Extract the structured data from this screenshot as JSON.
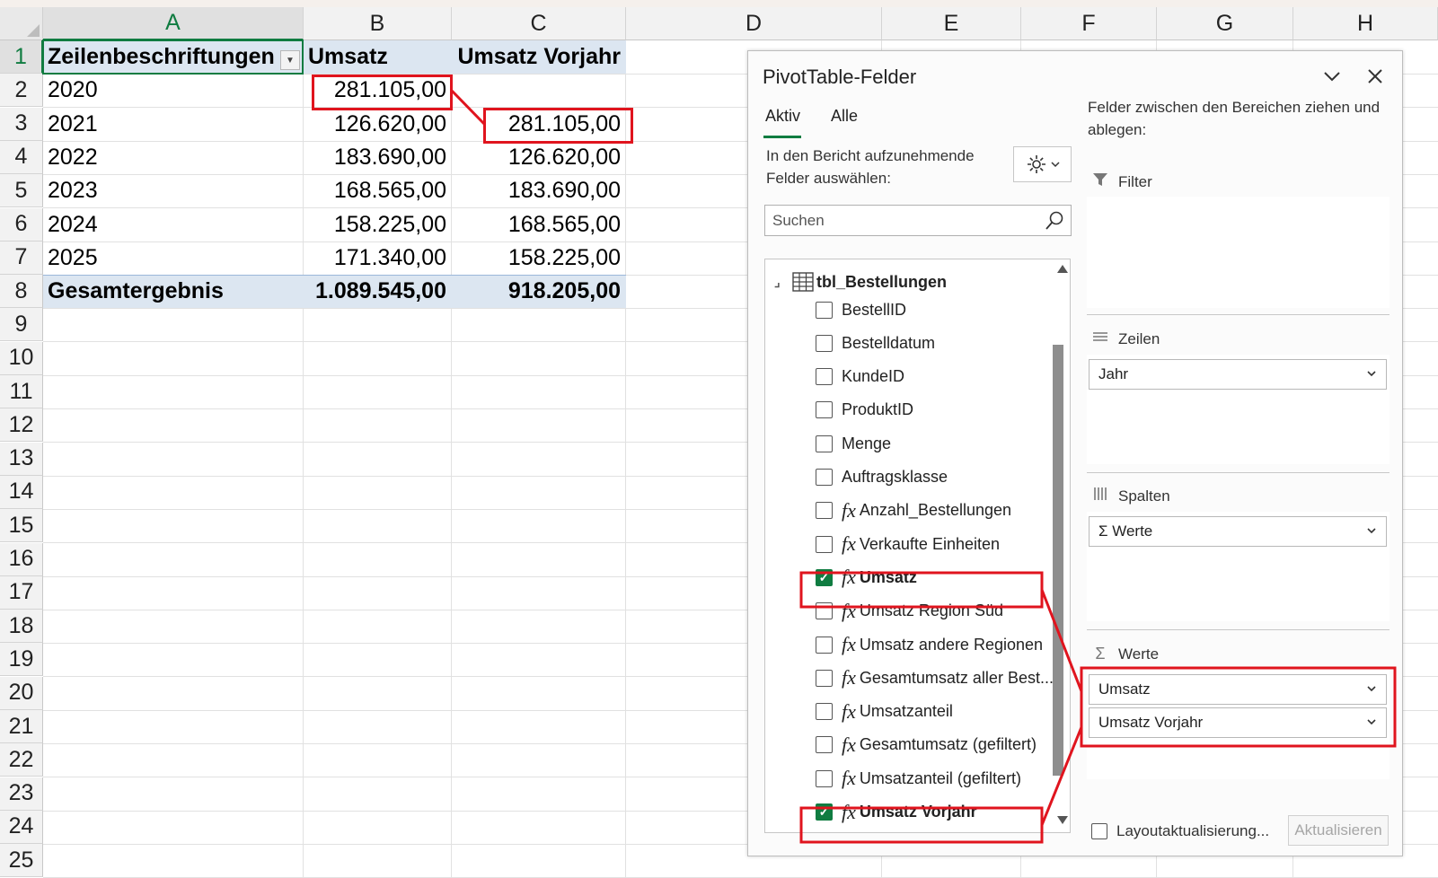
{
  "sheet": {
    "columns": [
      "A",
      "B",
      "C",
      "D",
      "E",
      "F",
      "G",
      "H"
    ],
    "rows": [
      "1",
      "2",
      "3",
      "4",
      "5",
      "6",
      "7",
      "8",
      "9",
      "10",
      "11",
      "12",
      "13",
      "14",
      "15",
      "16",
      "17",
      "18",
      "19",
      "20",
      "21",
      "22",
      "23",
      "24",
      "25"
    ],
    "pivot": {
      "headers": [
        "Zeilenbeschriftungen",
        "Umsatz",
        "Umsatz Vorjahr"
      ],
      "data": [
        [
          "2020",
          "281.105,00",
          ""
        ],
        [
          "2021",
          "126.620,00",
          "281.105,00"
        ],
        [
          "2022",
          "183.690,00",
          "126.620,00"
        ],
        [
          "2023",
          "168.565,00",
          "183.690,00"
        ],
        [
          "2024",
          "158.225,00",
          "168.565,00"
        ],
        [
          "2025",
          "171.340,00",
          "158.225,00"
        ]
      ],
      "total": [
        "Gesamtergebnis",
        "1.089.545,00",
        "918.205,00"
      ]
    }
  },
  "pane": {
    "title": "PivotTable-Felder",
    "tabs": [
      "Aktiv",
      "Alle"
    ],
    "active_tab": "Aktiv",
    "choose_text": "In den Bericht aufzunehmende Felder auswählen:",
    "search_placeholder": "Suchen",
    "table_name": "tbl_Bestellungen",
    "fields": [
      {
        "label": "BestellID",
        "checked": false,
        "measure": false
      },
      {
        "label": "Bestelldatum",
        "checked": false,
        "measure": false
      },
      {
        "label": "KundeID",
        "checked": false,
        "measure": false
      },
      {
        "label": "ProduktID",
        "checked": false,
        "measure": false
      },
      {
        "label": "Menge",
        "checked": false,
        "measure": false
      },
      {
        "label": "Auftragsklasse",
        "checked": false,
        "measure": false
      },
      {
        "label": "Anzahl_Bestellungen",
        "checked": false,
        "measure": true
      },
      {
        "label": "Verkaufte Einheiten",
        "checked": false,
        "measure": true
      },
      {
        "label": "Umsatz",
        "checked": true,
        "measure": true
      },
      {
        "label": "Umsatz Region Süd",
        "checked": false,
        "measure": true
      },
      {
        "label": "Umsatz andere Regionen",
        "checked": false,
        "measure": true
      },
      {
        "label": "Gesamtumsatz aller Best...",
        "checked": false,
        "measure": true
      },
      {
        "label": "Umsatzanteil",
        "checked": false,
        "measure": true
      },
      {
        "label": "Gesamtumsatz (gefiltert)",
        "checked": false,
        "measure": true
      },
      {
        "label": "Umsatzanteil (gefiltert)",
        "checked": false,
        "measure": true
      },
      {
        "label": "Umsatz Vorjahr",
        "checked": true,
        "measure": true
      }
    ],
    "drag_text": "Felder zwischen den Bereichen ziehen und ablegen:",
    "areas": {
      "filter": {
        "label": "Filter",
        "items": []
      },
      "rows": {
        "label": "Zeilen",
        "items": [
          "Jahr"
        ]
      },
      "columns": {
        "label": "Spalten",
        "items": [
          "Σ Werte"
        ]
      },
      "values": {
        "label": "Werte",
        "items": [
          "Umsatz",
          "Umsatz Vorjahr"
        ]
      }
    },
    "defer_label": "Layoutaktualisierung...",
    "update_button": "Aktualisieren"
  },
  "colors": {
    "excel_green": "#107c41",
    "highlight_red": "#e0141e",
    "pivot_band": "#dce6f1"
  }
}
